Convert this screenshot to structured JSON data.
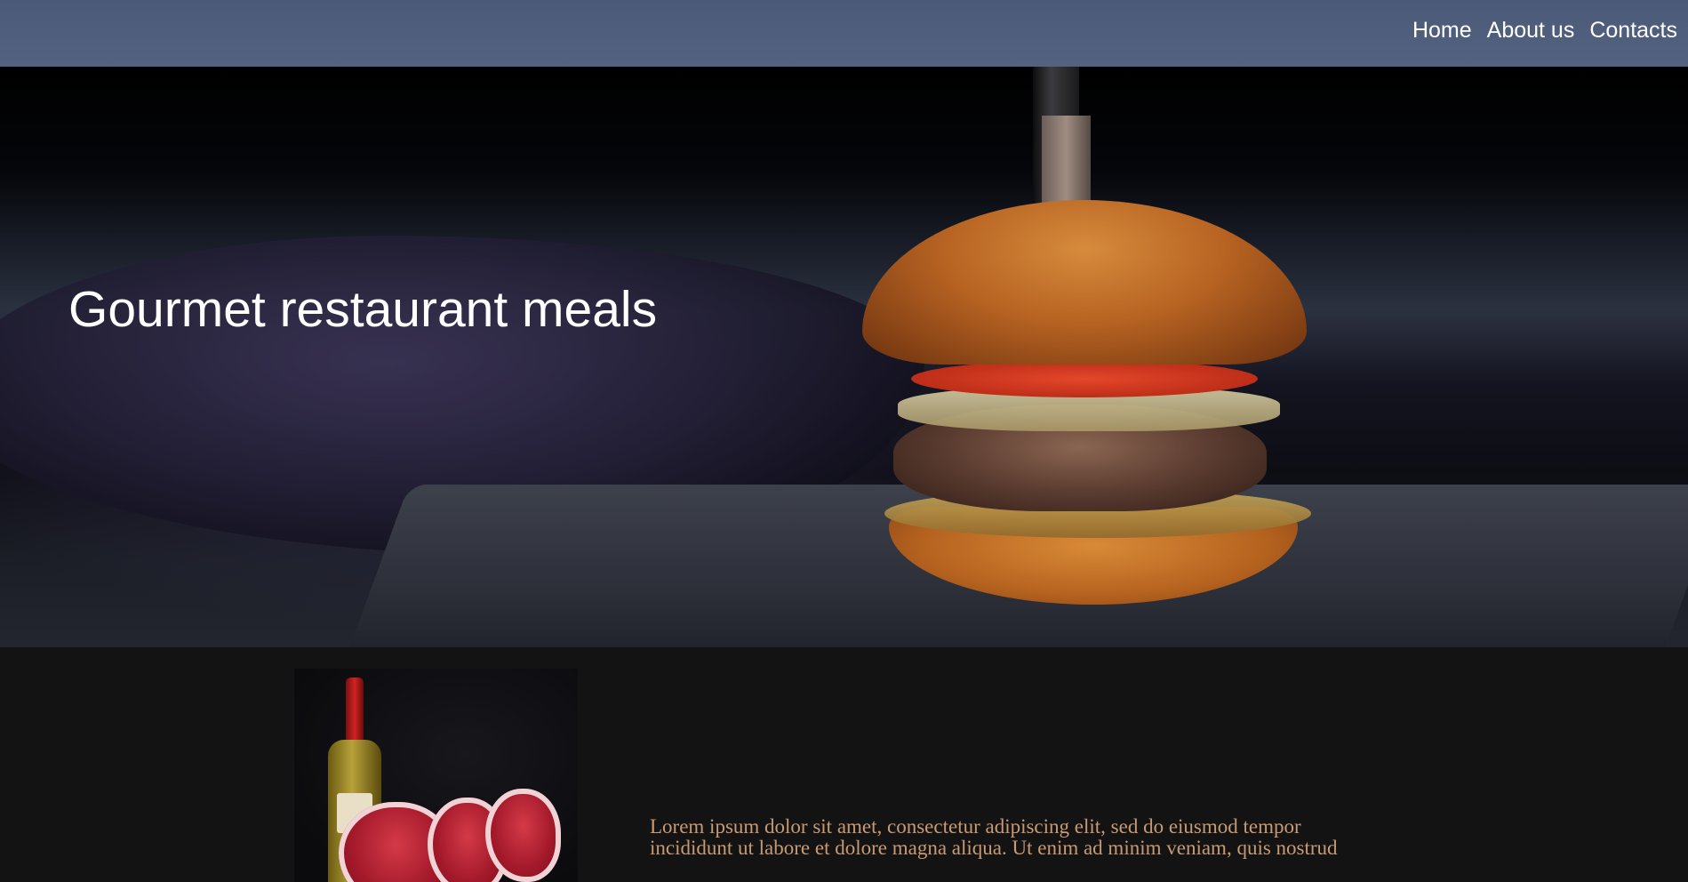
{
  "nav": {
    "links": [
      "Home",
      "About us",
      "Contacts"
    ]
  },
  "hero": {
    "title": "Gourmet restaurant meals"
  },
  "feature": {
    "text": "Lorem ipsum dolor sit amet, consectetur adipiscing elit, sed do eiusmod tempor incididunt ut labore et dolore magna aliqua. Ut enim ad minim veniam, quis nostrud"
  },
  "colors": {
    "navbar_bg": "#4f5f7d",
    "page_bg": "#131314",
    "accent_text": "#c99a72"
  }
}
